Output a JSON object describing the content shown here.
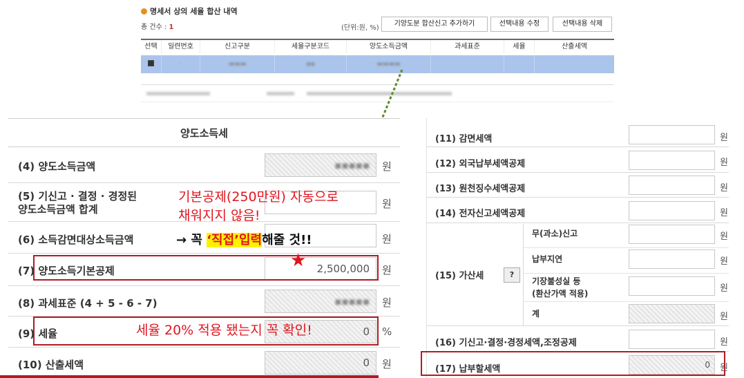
{
  "detail_panel": {
    "title": "명세서 상의 세율 합산 내역",
    "count_label": "총 건수 :",
    "count_value": "1",
    "unit_label": "(단위:원, %)",
    "buttons": [
      "기양도분 합산신고 추가하기",
      "선택내용 수정",
      "선택내용 삭제"
    ],
    "columns": [
      "선택",
      "일련번호",
      "신고구분",
      "세율구분코드",
      "양도소득금액",
      "과세표준",
      "세율",
      "산출세액"
    ]
  },
  "left_panel": {
    "title": "양도소득세",
    "rows": [
      {
        "label": "(4) 양도소득금액",
        "value": "",
        "unit": "원"
      },
      {
        "label": "(5) 기신고 · 결정 · 경정된",
        "label2": "양도소득금액 합계",
        "value": "",
        "unit": "원"
      },
      {
        "label": "(6) 소득감면대상소득금액",
        "value": "",
        "unit": "원"
      },
      {
        "label": "(7) 양도소득기본공제",
        "value": "2,500,000",
        "unit": "원"
      },
      {
        "label": "(8) 과세표준 (4 + 5 - 6 - 7)",
        "value": "",
        "unit": "원"
      },
      {
        "label": "(9) 세율",
        "value": "0",
        "unit": "%"
      },
      {
        "label": "(10) 산출세액",
        "value": "0",
        "unit": "원"
      }
    ],
    "annotations": {
      "deduction_line1": "기본공제(250만원) 자동으로",
      "deduction_line2": "채워지지 않음!",
      "direct_input_arrow": "→ 꼭",
      "direct_input_highlight": "‘직접’",
      "direct_input_red": "입력",
      "direct_input_rest": "해줄 것!!",
      "tax_rate_check": "세율 20% 적용 됐는지 꼭 확인!"
    }
  },
  "right_panel": {
    "rows": [
      {
        "label": "(11) 감면세액",
        "unit": "원"
      },
      {
        "label": "(12) 외국납부세액공제",
        "unit": "원"
      },
      {
        "label": "(13) 원천징수세액공제",
        "unit": "원"
      },
      {
        "label": "(14) 전자신고세액공제",
        "unit": "원"
      },
      {
        "label": "(16) 기신고·결정·경정세액,조정공제",
        "unit": "원"
      },
      {
        "label": "(17) 납부할세액",
        "value": "0",
        "unit": "원"
      }
    ],
    "penalty": {
      "label": "(15) 가산세",
      "help": "?",
      "sub_rows": [
        {
          "label": "무(과소)신고",
          "unit": "원"
        },
        {
          "label": "납부지연",
          "unit": "원"
        },
        {
          "label": "기장불성실 등",
          "label2": "(환산가액 적용)",
          "unit": "원"
        },
        {
          "label": "계",
          "unit": "원"
        }
      ]
    }
  },
  "colors": {
    "highlight_row": "#aac4ec",
    "annotation_red": "#e0141e",
    "box_red": "#b01b22",
    "marker_yellow": "#fff200",
    "arrow_green": "#5b8a2e"
  },
  "icons": [
    "bullet-dot-icon",
    "star-icon",
    "arrow-connector-icon"
  ]
}
